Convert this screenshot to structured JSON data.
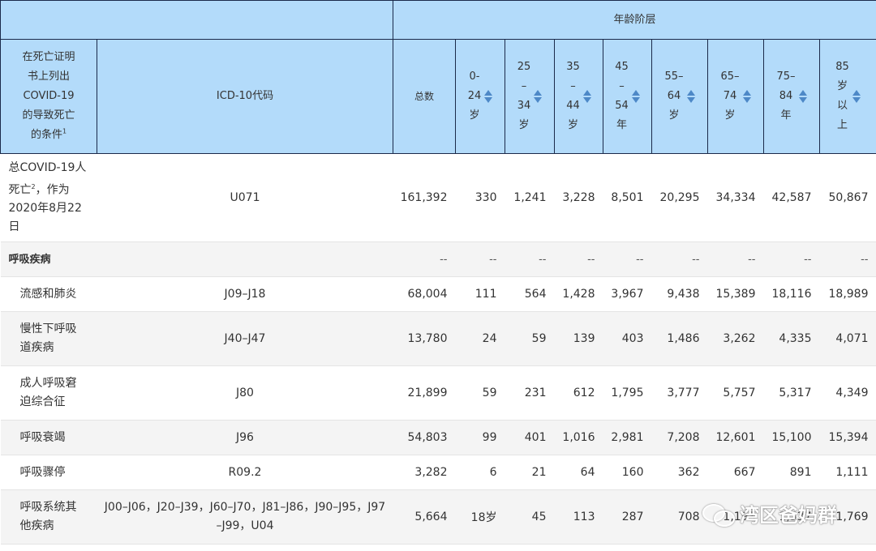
{
  "header": {
    "group_label": "年龄阶层",
    "condition_lines": [
      "在死亡证明",
      "书上列出",
      "COVID-19",
      "的导致死亡",
      "的条件"
    ],
    "condition_footnote": "1",
    "icd_label": "ICD-10代码",
    "total_label": "总数",
    "age_groups": [
      {
        "lines": [
          "0-",
          "24",
          "岁"
        ]
      },
      {
        "lines": [
          "25",
          "–",
          "34",
          "岁"
        ]
      },
      {
        "lines": [
          "35",
          "–",
          "44",
          "岁"
        ]
      },
      {
        "lines": [
          "45",
          "–",
          "54",
          "年"
        ]
      },
      {
        "lines": [
          "55–",
          "64",
          "岁"
        ]
      },
      {
        "lines": [
          "65–",
          "74",
          "岁"
        ]
      },
      {
        "lines": [
          "75–",
          "84",
          "年"
        ]
      },
      {
        "lines": [
          "85",
          "岁",
          "以",
          "上"
        ]
      }
    ]
  },
  "total_row": {
    "name_l1": "总COVID-19人",
    "name_l2": "死亡",
    "footnote": "2",
    "name_l2b": "，作为",
    "name_l3": "2020年8月22",
    "name_l4": "日",
    "code": "U071",
    "values": [
      "161,392",
      "330",
      "1,241",
      "3,228",
      "8,501",
      "20,295",
      "34,334",
      "42,587",
      "50,867"
    ]
  },
  "section": {
    "title": "呼吸疾病",
    "placeholder": "--"
  },
  "rows": [
    {
      "name": [
        "流感和肺炎"
      ],
      "code": [
        "J09–J18"
      ],
      "values": [
        "68,004",
        "111",
        "564",
        "1,428",
        "3,967",
        "9,438",
        "15,389",
        "18,116",
        "18,989"
      ]
    },
    {
      "name": [
        "慢性下呼吸",
        "道疾病"
      ],
      "code": [
        "J40–J47"
      ],
      "values": [
        "13,780",
        "24",
        "59",
        "139",
        "403",
        "1,486",
        "3,262",
        "4,335",
        "4,071"
      ]
    },
    {
      "name": [
        "成人呼吸窘",
        "迫综合征"
      ],
      "code": [
        "J80"
      ],
      "values": [
        "21,899",
        "59",
        "231",
        "612",
        "1,795",
        "3,777",
        "5,757",
        "5,317",
        "4,349"
      ]
    },
    {
      "name": [
        "呼吸衰竭"
      ],
      "code": [
        "J96"
      ],
      "values": [
        "54,803",
        "99",
        "401",
        "1,016",
        "2,981",
        "7,208",
        "12,601",
        "15,100",
        "15,394"
      ]
    },
    {
      "name": [
        "呼吸骤停"
      ],
      "code": [
        "R09.2"
      ],
      "values": [
        "3,282",
        "6",
        "21",
        "64",
        "160",
        "362",
        "667",
        "891",
        "1,111"
      ]
    },
    {
      "name": [
        "呼吸系统其",
        "他疾病"
      ],
      "code": [
        "J00–J06，J20–J39，J60–J70，J81–J86，J90–J95，J97",
        "–J99，U04"
      ],
      "values": [
        "5,664",
        "18岁",
        "45",
        "113",
        "287",
        "708",
        "1,193",
        "1,537",
        "1,769"
      ]
    }
  ],
  "watermark": {
    "text": "湾区爸妈群",
    "icon": "wechat-icon"
  }
}
